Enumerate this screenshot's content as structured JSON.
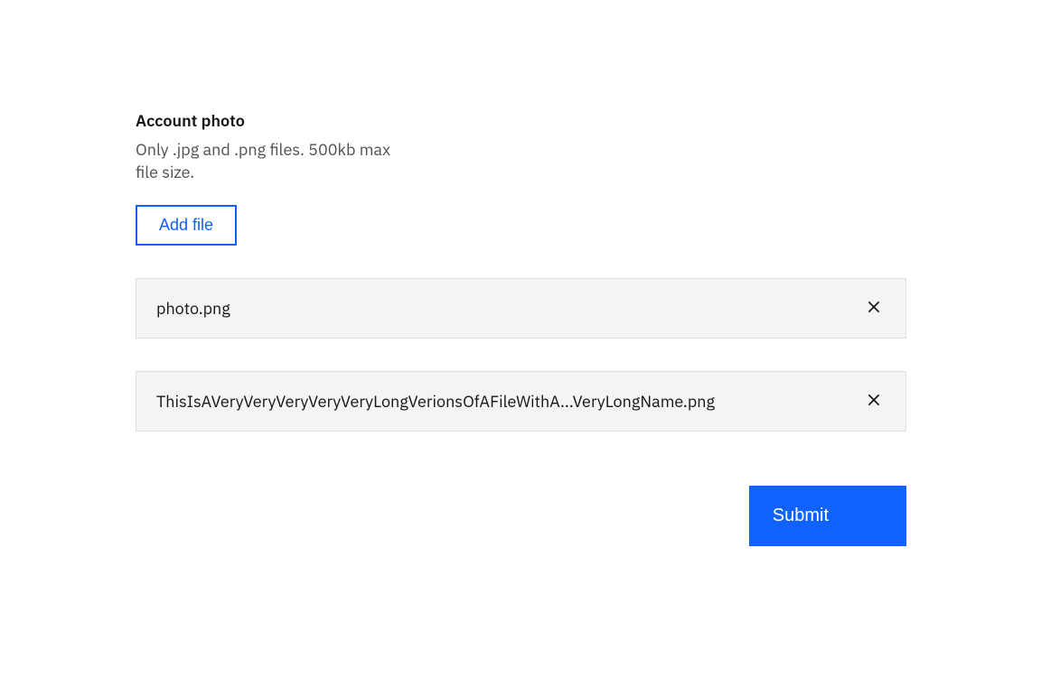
{
  "uploader": {
    "title": "Account photo",
    "description": "Only .jpg and .png files. 500kb max file size.",
    "add_file_label": "Add file",
    "files": [
      {
        "name": "photo.png"
      },
      {
        "name": "ThisIsAVeryVeryVeryVeryVeryLongVerionsOfAFileWithA...VeryLongName.png"
      }
    ],
    "submit_label": "Submit"
  }
}
